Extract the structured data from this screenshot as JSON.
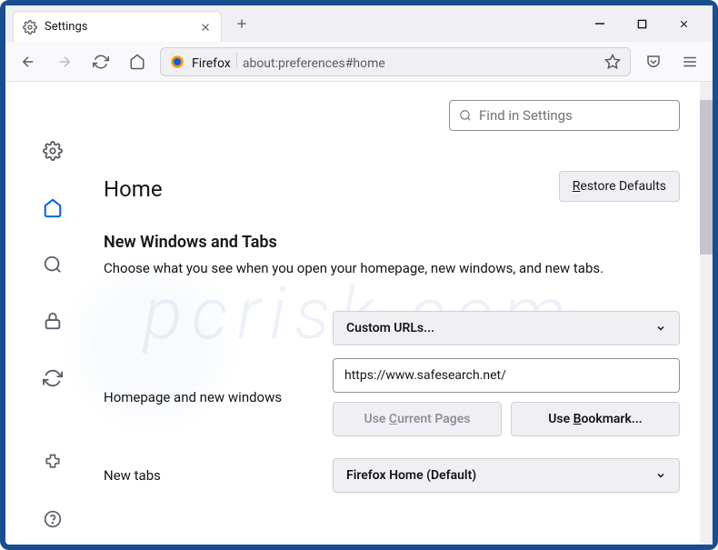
{
  "tab": {
    "title": "Settings"
  },
  "addressbar": {
    "prefix": "Firefox",
    "url": "about:preferences#home"
  },
  "search": {
    "placeholder": "Find in Settings"
  },
  "page": {
    "title": "Home",
    "restore": "estore Defaults"
  },
  "section": {
    "title": "New Windows and Tabs",
    "desc": "Choose what you see when you open your homepage, new windows, and new tabs."
  },
  "homepage": {
    "label": "Homepage and new windows",
    "select": "Custom URLs...",
    "value": "https://www.safesearch.net/",
    "use_current": "urrent Pages",
    "use_bookmark": "ookmark..."
  },
  "newtabs": {
    "label": "New tabs",
    "select": "Firefox Home (Default)"
  }
}
